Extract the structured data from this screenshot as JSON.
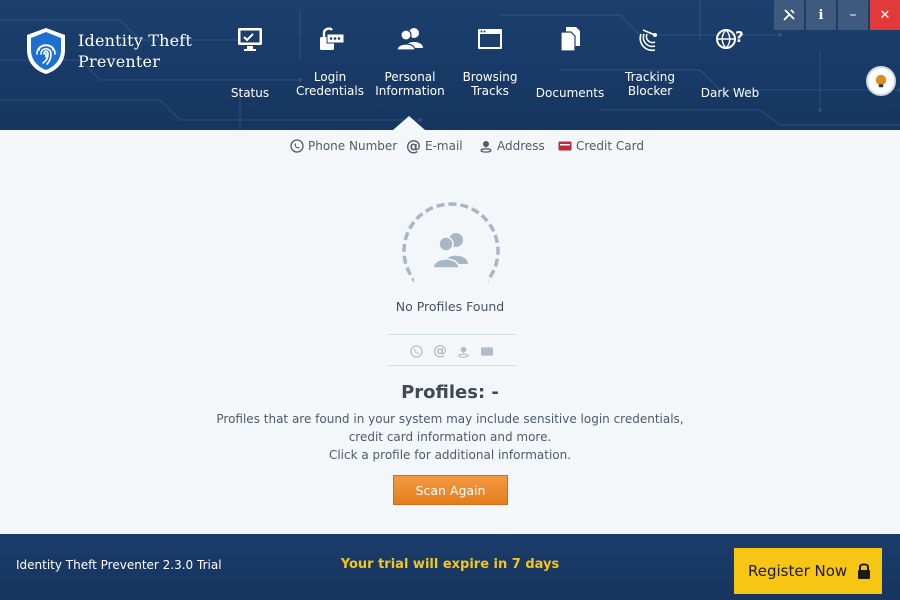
{
  "app": {
    "brand_line1": "Identity Theft",
    "brand_line2": "Preventer"
  },
  "nav": {
    "items": [
      {
        "label1": "Status",
        "label2": "",
        "icon": "monitor-icon"
      },
      {
        "label1": "Login",
        "label2": "Credentials",
        "icon": "lock-password-icon"
      },
      {
        "label1": "Personal",
        "label2": "Information",
        "icon": "users-icon"
      },
      {
        "label1": "Browsing",
        "label2": "Tracks",
        "icon": "browser-window-icon"
      },
      {
        "label1": "Documents",
        "label2": "",
        "icon": "documents-icon"
      },
      {
        "label1": "Tracking",
        "label2": "Blocker",
        "icon": "radar-icon"
      },
      {
        "label1": "Dark Web",
        "label2": "",
        "icon": "globe-question-icon"
      }
    ],
    "active_index": 2
  },
  "window_buttons": {
    "tools": "tools-icon",
    "info": "i",
    "minimize": "–",
    "close": "✕"
  },
  "subtabs": [
    {
      "label": "Phone Number",
      "icon": "phone-icon"
    },
    {
      "label": "E-mail",
      "icon": "at-icon"
    },
    {
      "label": "Address",
      "icon": "location-pin-icon"
    },
    {
      "label": "Credit Card",
      "icon": "credit-card-icon"
    }
  ],
  "main": {
    "empty_state": "No Profiles Found",
    "profiles_title": "Profiles: -",
    "desc_line1": "Profiles that are found in your system may include sensitive login credentials,",
    "desc_line2": "credit card information and more.",
    "desc_line3": "Click a profile for additional information.",
    "scan_button": "Scan Again"
  },
  "footer": {
    "version": "Identity Theft Preventer 2.3.0 Trial",
    "trial_notice": "Your trial will expire in 7 days",
    "register_button": "Register Now"
  },
  "colors": {
    "header_bg": "#1c3f6e",
    "accent_orange": "#e98a2a",
    "trial_yellow": "#f5c518",
    "register_yellow": "#f7c513",
    "close_red": "#e23a3a"
  }
}
